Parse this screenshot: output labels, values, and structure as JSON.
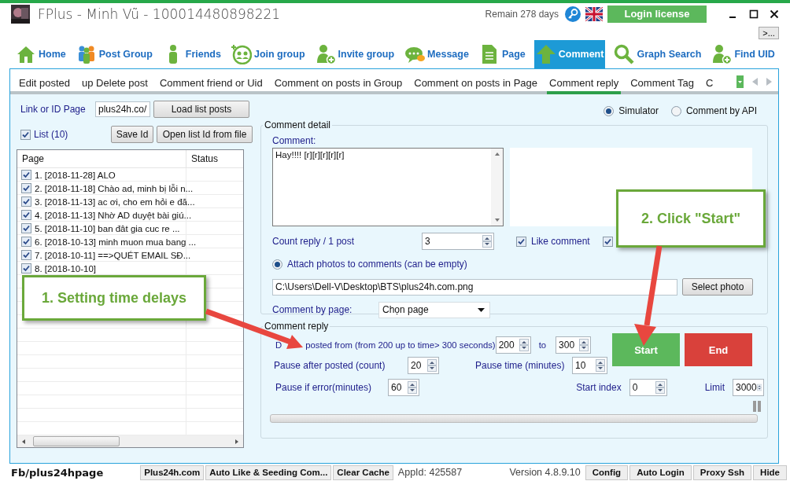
{
  "window": {
    "title": "FPlus - Minh Vũ - 100014480898221",
    "remaining": "Remain 278 days",
    "login_button": "Login license",
    "more_button": ">..."
  },
  "nav_tabs": [
    {
      "label": "Home",
      "selected": false
    },
    {
      "label": "Post Group",
      "selected": false
    },
    {
      "label": "Friends",
      "selected": false
    },
    {
      "label": "Join group",
      "selected": false
    },
    {
      "label": "Invite group",
      "selected": false
    },
    {
      "label": "Message",
      "selected": false
    },
    {
      "label": "Page",
      "selected": false
    },
    {
      "label": "Comment",
      "selected": true
    },
    {
      "label": "Graph Search",
      "selected": false
    },
    {
      "label": "Find UID",
      "selected": false
    }
  ],
  "sub_tabs": [
    {
      "label": "Edit posted",
      "selected": false
    },
    {
      "label": "up Delete post",
      "selected": false
    },
    {
      "label": "Comment friend or Uid",
      "selected": false
    },
    {
      "label": "Comment on posts in Group",
      "selected": false
    },
    {
      "label": "Comment on posts in Page",
      "selected": false
    },
    {
      "label": "Comment reply",
      "selected": true
    },
    {
      "label": "Comment Tag",
      "selected": false
    },
    {
      "label": "C",
      "selected": false
    }
  ],
  "left": {
    "link_label": "Link or ID Page",
    "link_value": "plus24h.co/",
    "load_button": "Load list posts",
    "list_checkbox": {
      "label": "List (10)",
      "checked": true
    },
    "save_button": "Save Id",
    "open_button": "Open list Id from file",
    "table": {
      "columns": [
        "Page",
        "Status"
      ],
      "rows": [
        {
          "page": "1. [2018-11-28] ALO",
          "checked": true
        },
        {
          "page": "2. [2018-11-18] Chào ad, minh bị lỗi n...",
          "checked": true
        },
        {
          "page": "3. [2018-11-13] ac ơi, cho em hỏi e đă...",
          "checked": true
        },
        {
          "page": "4. [2018-11-13] Nhờ AD duyệt bài giú...",
          "checked": true
        },
        {
          "page": "5. [2018-11-10] ban đât  gia cuc re     ...",
          "checked": true
        },
        {
          "page": "6. [2018-10-13] minh muon mua bang ...",
          "checked": true
        },
        {
          "page": "7. [2018-10-11] ==>QUÉT EMAIL SĐ...",
          "checked": true
        },
        {
          "page": "8. [2018-10-10]",
          "checked": true
        }
      ]
    }
  },
  "mode_radios": [
    {
      "label": "Simulator",
      "selected": true
    },
    {
      "label": "Comment by API",
      "selected": false
    }
  ],
  "comment_detail": {
    "title": "Comment detail",
    "comment_label": "Comment:",
    "comment_value": "Hay!!!! [r][r][r][r][r]",
    "count_label": "Count reply / 1 post",
    "count_value": "3",
    "like_comment": {
      "label": "Like comment",
      "checked": true
    },
    "delete_comment": {
      "checked": true
    },
    "attach": {
      "label": "Attach photos to comments (can be empty)",
      "selected": true
    },
    "photo_path": "C:\\Users\\Dell-V\\Desktop\\BTS\\plus24h.com.png",
    "select_photo_button": "Select photo",
    "page_label": "Comment by page:",
    "page_value": "Chọn page"
  },
  "comment_reply": {
    "title": "Comment reply",
    "delay_label_start": "D",
    "delay_label_rest": "posted from (from 200 up to time> 300 seconds)",
    "delay_from": "200",
    "to_label": "to",
    "delay_to": "300",
    "pause_after_label": "Pause after posted (count)",
    "pause_after": "20",
    "pause_time_label": "Pause time (minutes)",
    "pause_time": "10",
    "pause_error_label": "Pause if error(minutes)",
    "pause_error": "60",
    "start_index_label": "Start index",
    "start_index": "0",
    "limit_label": "Limit",
    "limit": "3000",
    "start_button": "Start",
    "end_button": "End",
    "progress": {
      "level": 0
    }
  },
  "callouts": [
    {
      "text": "1. Setting time delays"
    },
    {
      "text": "2. Click \"Start\""
    }
  ],
  "status_bar": {
    "page_link": "Fb/plus24hpage",
    "buttons_left": [
      "Plus24h.com",
      "Auto Like & Seeding Com...",
      "Clear Cache"
    ],
    "app_id": "AppId: 425587",
    "version": "Version 4.8.9.10",
    "buttons_right": [
      "Config",
      "Auto Login",
      "Proxy Ssh",
      "Hide"
    ]
  }
}
